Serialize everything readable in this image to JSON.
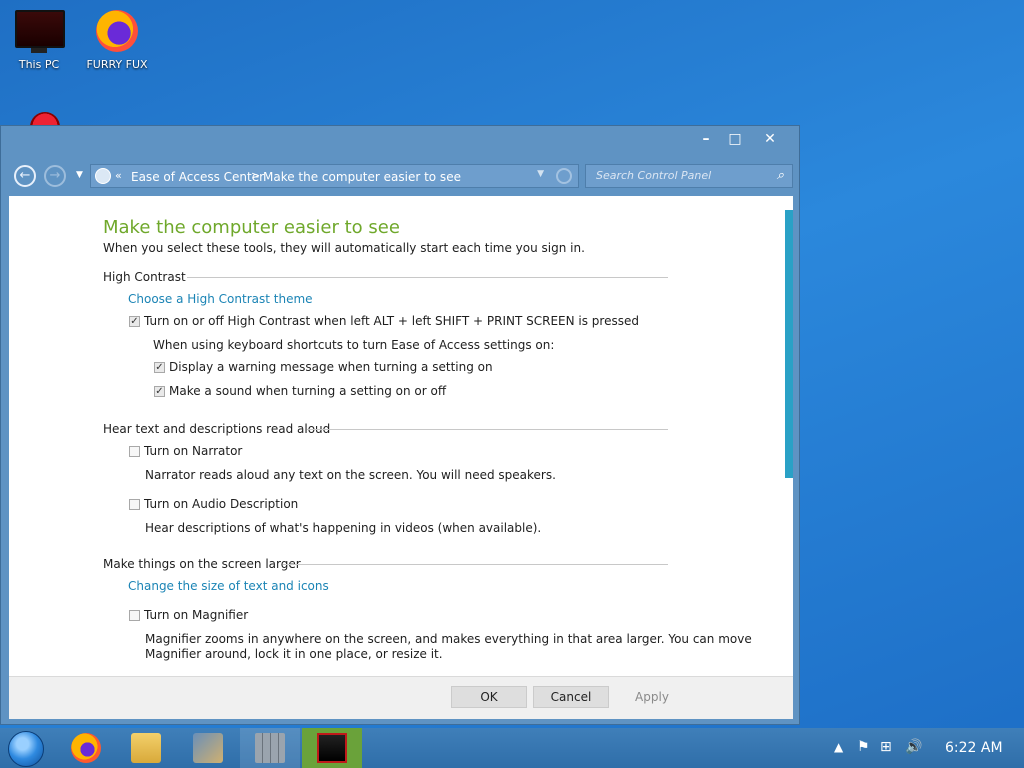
{
  "desktop": {
    "icons": [
      {
        "label": "This PC"
      },
      {
        "label": "FURRY FUX"
      }
    ]
  },
  "window": {
    "controls": {
      "minimize": "–",
      "maximize": "□",
      "close": "✕"
    },
    "address": {
      "chevron": "«",
      "crumbs": [
        "Ease of Access Center",
        "Make the computer easier to see"
      ],
      "separator": ">"
    },
    "search": {
      "placeholder": "Search Control Panel"
    },
    "content": {
      "title": "Make the computer easier to see",
      "subtitle": "When you select these tools, they will automatically start each time you sign in.",
      "high_contrast": {
        "heading": "High Contrast",
        "theme_link": "Choose a High Contrast theme",
        "toggle": {
          "label": "Turn on or off High Contrast when left ALT + left SHIFT + PRINT SCREEN is pressed",
          "checked": true
        },
        "shortcut_note": "When using keyboard shortcuts to turn Ease of Access settings on:",
        "warning": {
          "label": "Display a warning message when turning a setting on",
          "checked": true
        },
        "sound": {
          "label": "Make a sound when turning a setting on or off",
          "checked": true
        }
      },
      "narration": {
        "heading": "Hear text and descriptions read aloud",
        "narrator": {
          "label": "Turn on Narrator",
          "checked": false,
          "desc": "Narrator reads aloud any text on the screen. You will need speakers."
        },
        "audio_desc": {
          "label": "Turn on Audio Description",
          "checked": false,
          "desc": "Hear descriptions of what's happening in videos (when available)."
        }
      },
      "larger": {
        "heading": "Make things on the screen larger",
        "size_link": "Change the size of text and icons",
        "magnifier": {
          "label": "Turn on Magnifier",
          "checked": false,
          "desc_line1": "Magnifier zooms in anywhere on the screen, and makes everything in that area larger. You can move",
          "desc_line2": "Magnifier around, lock it in one place, or resize it."
        }
      }
    },
    "footer": {
      "ok": "OK",
      "cancel": "Cancel",
      "apply": "Apply"
    }
  },
  "taskbar": {
    "clock": "6:22 AM",
    "tray_icons": [
      "flag-icon",
      "network-icon",
      "volume-icon"
    ],
    "apps": [
      "firefox-icon",
      "file-explorer-icon",
      "control-panel-icon",
      "wall-app-icon",
      "monitor-app-icon"
    ]
  },
  "colors": {
    "accent_title": "#6fa82b",
    "link": "#1b84b5",
    "scrollbar": "#2aa1c6",
    "taskbar_highlight": "#6aa23a"
  }
}
